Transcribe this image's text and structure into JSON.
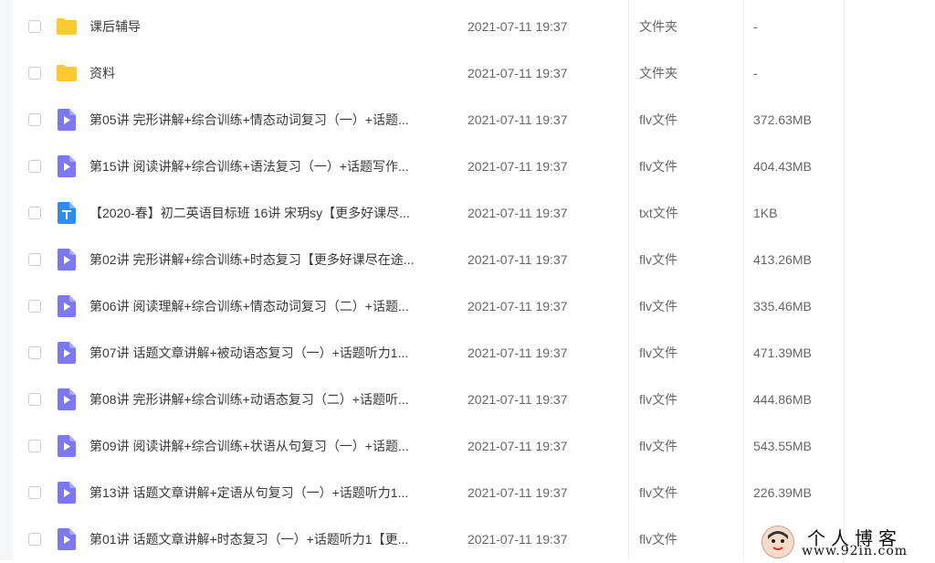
{
  "files": [
    {
      "icon": "folder-icon",
      "name": "课后辅导",
      "date": "2021-07-11 19:37",
      "type": "文件夹",
      "size": "-"
    },
    {
      "icon": "folder-icon",
      "name": "资料",
      "date": "2021-07-11 19:37",
      "type": "文件夹",
      "size": "-"
    },
    {
      "icon": "video-file-icon",
      "name": "第05讲 完形讲解+综合训练+情态动词复习（一）+话题...",
      "date": "2021-07-11 19:37",
      "type": "flv文件",
      "size": "372.63MB"
    },
    {
      "icon": "video-file-icon",
      "name": "第15讲 阅读讲解+综合训练+语法复习（一）+话题写作...",
      "date": "2021-07-11 19:37",
      "type": "flv文件",
      "size": "404.43MB"
    },
    {
      "icon": "text-file-icon",
      "name": "【2020-春】初二英语目标班 16讲 宋玥sy【更多好课尽...",
      "date": "2021-07-11 19:37",
      "type": "txt文件",
      "size": "1KB"
    },
    {
      "icon": "video-file-icon",
      "name": "第02讲 完形讲解+综合训练+时态复习【更多好课尽在途...",
      "date": "2021-07-11 19:37",
      "type": "flv文件",
      "size": "413.26MB"
    },
    {
      "icon": "video-file-icon",
      "name": "第06讲 阅读理解+综合训练+情态动词复习（二）+话题...",
      "date": "2021-07-11 19:37",
      "type": "flv文件",
      "size": "335.46MB"
    },
    {
      "icon": "video-file-icon",
      "name": "第07讲 话题文章讲解+被动语态复习（一）+话题听力1...",
      "date": "2021-07-11 19:37",
      "type": "flv文件",
      "size": "471.39MB"
    },
    {
      "icon": "video-file-icon",
      "name": "第08讲 完形讲解+综合训练+动语态复习（二）+话题听...",
      "date": "2021-07-11 19:37",
      "type": "flv文件",
      "size": "444.86MB"
    },
    {
      "icon": "video-file-icon",
      "name": "第09讲 阅读讲解+综合训练+状语从句复习（一）+话题...",
      "date": "2021-07-11 19:37",
      "type": "flv文件",
      "size": "543.55MB"
    },
    {
      "icon": "video-file-icon",
      "name": "第13讲 话题文章讲解+定语从句复习（一）+话题听力1...",
      "date": "2021-07-11 19:37",
      "type": "flv文件",
      "size": "226.39MB"
    },
    {
      "icon": "video-file-icon",
      "name": "第01讲 话题文章讲解+时态复习（一）+话题听力1【更...",
      "date": "2021-07-11 19:37",
      "type": "flv文件",
      "size": ""
    }
  ],
  "colors": {
    "folder": "#ffc933",
    "video": "#7b78f2",
    "text": "#2d8cf0"
  },
  "watermark": {
    "title": "个人博客",
    "url": "www.92in.com"
  }
}
